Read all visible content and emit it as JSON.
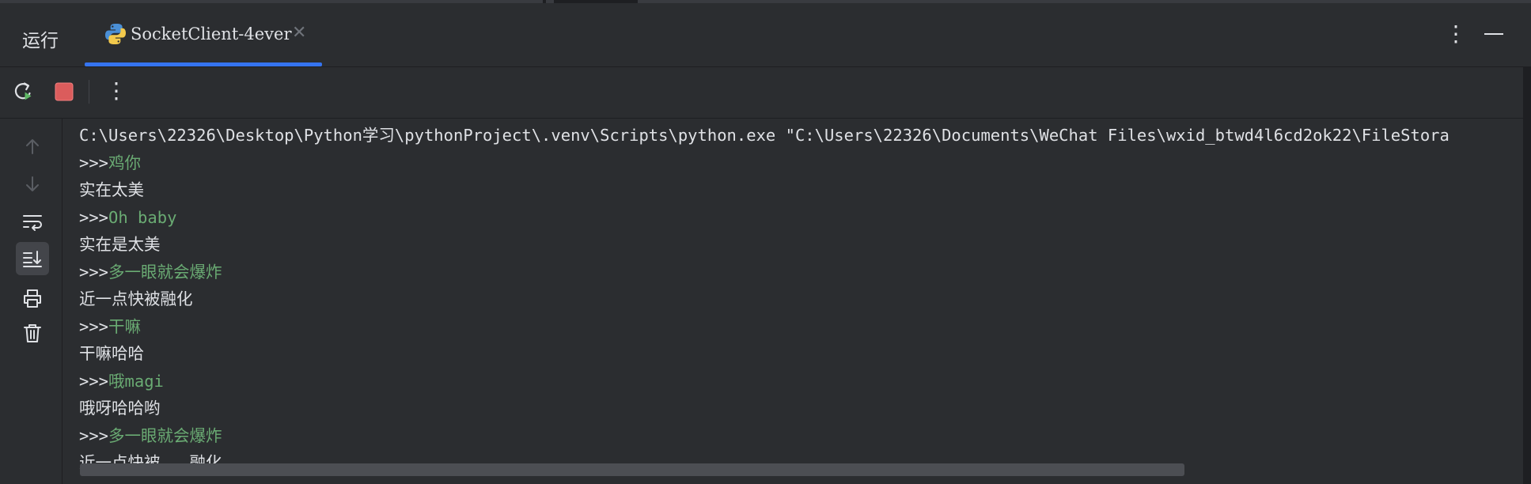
{
  "panel": {
    "title": "运行",
    "tab_label": "SocketClient-4ever",
    "tab_icon": "python-icon",
    "close_glyph": "✕",
    "more_glyph": "⋮"
  },
  "toolbar": {
    "rerun_icon": "rerun-icon",
    "stop_icon": "stop-icon",
    "more_glyph": "⋮"
  },
  "sidebar": {
    "items": [
      {
        "name": "scroll-up-icon"
      },
      {
        "name": "scroll-down-icon"
      },
      {
        "name": "soft-wrap-icon"
      },
      {
        "name": "scroll-to-end-icon"
      },
      {
        "name": "print-icon"
      },
      {
        "name": "clear-all-icon"
      }
    ]
  },
  "console": {
    "command": "C:\\Users\\22326\\Desktop\\Python学习\\pythonProject\\.venv\\Scripts\\python.exe \"C:\\Users\\22326\\Documents\\WeChat Files\\wxid_btwd4l6cd2ok22\\FileStora",
    "lines": [
      {
        "prompt": ">>>",
        "input": "鸡你"
      },
      {
        "output": "实在太美"
      },
      {
        "prompt": ">>>",
        "input": "Oh baby"
      },
      {
        "output": "实在是太美"
      },
      {
        "prompt": ">>>",
        "input": "多一眼就会爆炸"
      },
      {
        "output": "近一点快被融化"
      },
      {
        "prompt": ">>>",
        "input": "干嘛"
      },
      {
        "output": "干嘛哈哈"
      },
      {
        "prompt": ">>>",
        "input": "哦magi"
      },
      {
        "output": "哦呀哈哈哟"
      },
      {
        "prompt": ">>>",
        "input": "多一眼就会爆炸"
      },
      {
        "output": "近一点快被...融化"
      }
    ]
  },
  "colors": {
    "background": "#2b2d30",
    "text": "#dfe1e5",
    "user_input": "#6aab73",
    "accent": "#3574f0",
    "stop": "#db5c5c",
    "rerun_green": "#5fb865"
  }
}
